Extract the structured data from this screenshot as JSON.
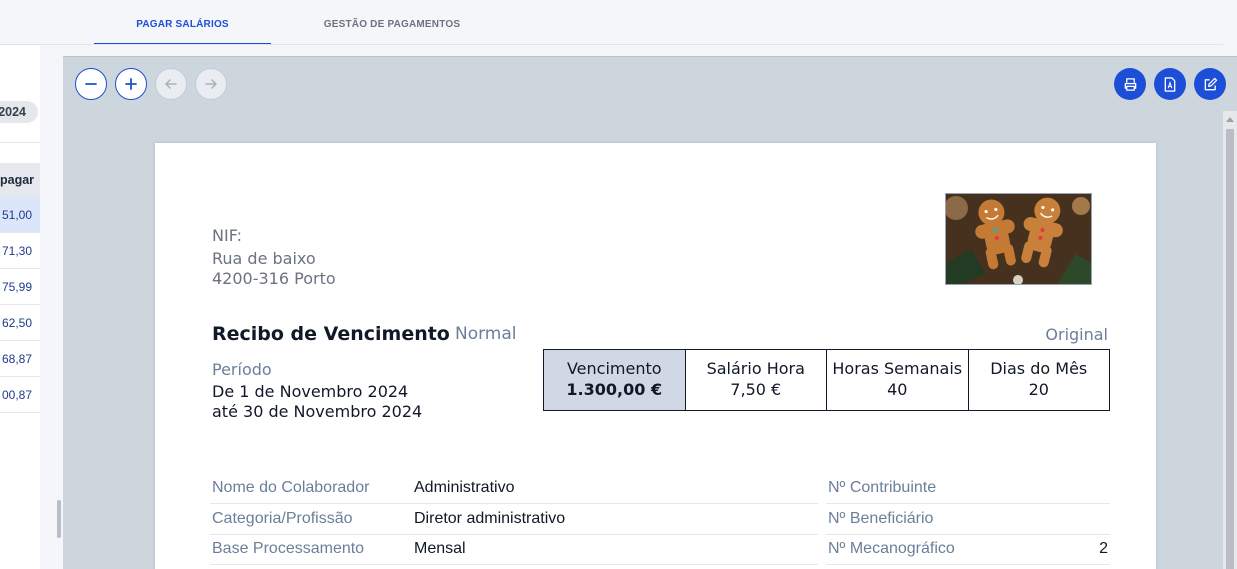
{
  "tabs": [
    {
      "label": "PAGAR SALÁRIOS",
      "active": true
    },
    {
      "label": "GESTÃO DE PAGAMENTOS",
      "active": false
    }
  ],
  "left_list": {
    "year": "2024",
    "header": "pagar",
    "rows": [
      "51,00",
      "71,30",
      "75,99",
      "62,50",
      "68,87",
      "00,87"
    ],
    "selected_index": 0
  },
  "toolbar": {
    "zoom_out_icon": "minus-icon",
    "zoom_in_icon": "plus-icon",
    "prev_icon": "arrow-left-icon",
    "next_icon": "arrow-right-icon",
    "print_icon": "printer-icon",
    "pdf_icon": "pdf-file-icon",
    "edit_icon": "edit-icon"
  },
  "receipt": {
    "company": {
      "nif_label": "NIF:",
      "address_line1": "Rua de baixo",
      "address_line2": "4200-316 Porto"
    },
    "title": "Recibo de Vencimento",
    "type": "Normal",
    "copy": "Original",
    "period": {
      "label": "Período",
      "from": "De 1 de Novembro 2024",
      "to": "até 30 de Novembro 2024"
    },
    "boxes": [
      {
        "label": "Vencimento",
        "value": "1.300,00 €"
      },
      {
        "label": "Salário Hora",
        "value": "7,50 €"
      },
      {
        "label": "Horas Semanais",
        "value": "40"
      },
      {
        "label": "Dias do Mês",
        "value": "20"
      }
    ],
    "employee": [
      {
        "label": "Nome do Colaborador",
        "value": "Administrativo"
      },
      {
        "label": "Categoria/Profissão",
        "value": "Diretor administrativo"
      },
      {
        "label": "Base Processamento",
        "value": "Mensal"
      }
    ],
    "ids": [
      {
        "label": "Nº Contribuinte",
        "value": ""
      },
      {
        "label": "Nº Beneficiário",
        "value": ""
      },
      {
        "label": "Nº Mecanográfico",
        "value": "2"
      }
    ]
  },
  "colors": {
    "accent": "#1d4ed8",
    "muted_label": "#6b7f99",
    "viewer_bg": "#cdd5dd"
  }
}
